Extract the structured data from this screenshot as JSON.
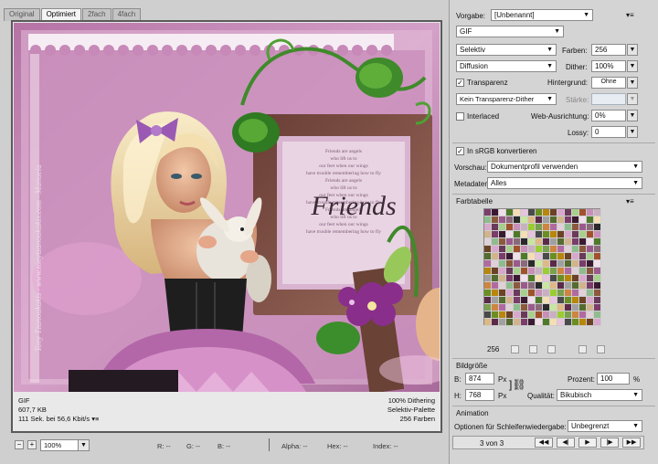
{
  "tabs": [
    "Original",
    "Optimiert",
    "2fach",
    "4fach"
  ],
  "artwork": {
    "frame_text": "Friends",
    "poem_lines": [
      "Friends are angels",
      "who lift us to",
      "our feet when our wings",
      "have trouble remembering how to fly",
      "Friends are angels",
      "who lift us to",
      "our feet when our wings",
      "have trouble remembering how to fly",
      "Friends are angels",
      "who lift us to",
      "our feet when our wings",
      "have trouble remembering how to fly"
    ],
    "watermark": "Tony Tzanoukakis · www.tonytzanoukakis.com · Manuela"
  },
  "info": {
    "format": "GIF",
    "filesize": "607,7 KB",
    "timing": "111 Sek. bei 56,6 Kbit/s",
    "dithering": "100% Dithering",
    "palette": "Selektiv-Palette",
    "colors": "256 Farben"
  },
  "statusbar": {
    "zoom": "100%",
    "readouts": [
      "R: --",
      "G: --",
      "B: --",
      "Alpha: --",
      "Hex: --",
      "Index: --"
    ]
  },
  "settings": {
    "vorgabe_label": "Vorgabe:",
    "vorgabe_value": "[Unbenannt]",
    "format": "GIF",
    "reduction": "Selektiv",
    "farben_label": "Farben:",
    "farben_value": "256",
    "dither_algo": "Diffusion",
    "dither_label": "Dither:",
    "dither_value": "100%",
    "transparenz_label": "Transparenz",
    "hintergrund_label": "Hintergrund:",
    "hintergrund_value": "Ohne",
    "transp_dither": "Kein Transparenz-Dither",
    "staerke_label": "Stärke:",
    "interlaced_label": "Interlaced",
    "web_label": "Web-Ausrichtung:",
    "web_value": "0%",
    "lossy_label": "Lossy:",
    "lossy_value": "0",
    "srgb_label": "In sRGB konvertieren",
    "vorschau_label": "Vorschau:",
    "vorschau_value": "Dokumentprofil verwenden",
    "metadaten_label": "Metadaten:",
    "metadaten_value": "Alles"
  },
  "farbtabelle": {
    "title": "Farbtabelle",
    "count": "256",
    "colors": [
      "#7a3d6a",
      "#9b5a8c",
      "#c88fb8",
      "#e6c4dc",
      "#5a2a48",
      "#b06aa0",
      "#d8a8cc",
      "#3a1a30",
      "#8a6a7a",
      "#c9b0c0",
      "#4a4a4a",
      "#a0a0a0",
      "#e0d0d8",
      "#6a3a5a",
      "#f0e0ea",
      "#2a2a2a",
      "#9acd32",
      "#6b8e23",
      "#556b2f",
      "#8fbc8f",
      "#a8d08d",
      "#4e7a2a",
      "#c8e6a0",
      "#7aa050",
      "#b8860b",
      "#d2b48c",
      "#8b5a3c",
      "#a0522d",
      "#f5deb3",
      "#deb887",
      "#cd853f",
      "#6b4226"
    ]
  },
  "bildgroesse": {
    "title": "Bildgröße",
    "b_label": "B:",
    "b_value": "874",
    "b_unit": "Px",
    "h_label": "H:",
    "h_value": "768",
    "h_unit": "Px",
    "prozent_label": "Prozent:",
    "prozent_value": "100",
    "prozent_unit": "%",
    "qualitaet_label": "Qualität:",
    "qualitaet_value": "Bikubisch"
  },
  "animation": {
    "title": "Animation",
    "loop_label": "Optionen für Schleifenwiedergabe:",
    "loop_value": "Unbegrenzt",
    "frame_counter": "3 von 3"
  }
}
